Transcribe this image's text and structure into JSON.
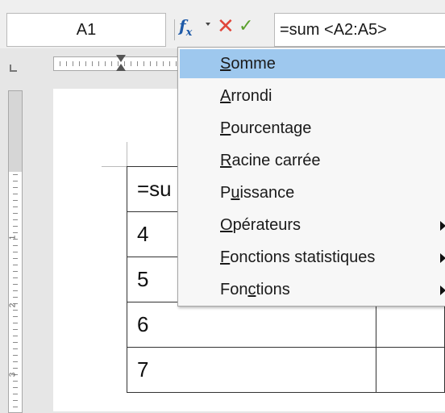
{
  "formula_bar": {
    "name_box": "A1",
    "fx_label": "f",
    "fx_sub": "x",
    "cancel_icon": "✕",
    "accept_icon": "✓",
    "formula": "=sum <A2:A5>"
  },
  "ruler": {
    "v_labels": [
      "1",
      "2",
      "3"
    ]
  },
  "table": {
    "rows": [
      "=su",
      "4",
      "5",
      "6",
      "7"
    ]
  },
  "menu": {
    "items": [
      {
        "pre": "",
        "u": "S",
        "post": "omme",
        "submenu": false,
        "highlight": true
      },
      {
        "pre": "",
        "u": "A",
        "post": "rrondi",
        "submenu": false,
        "highlight": false
      },
      {
        "pre": "",
        "u": "P",
        "post": "ourcentage",
        "submenu": false,
        "highlight": false
      },
      {
        "pre": "",
        "u": "R",
        "post": "acine carrée",
        "submenu": false,
        "highlight": false
      },
      {
        "pre": "P",
        "u": "u",
        "post": "issance",
        "submenu": false,
        "highlight": false
      },
      {
        "pre": "",
        "u": "O",
        "post": "pérateurs",
        "submenu": true,
        "highlight": false
      },
      {
        "pre": "",
        "u": "F",
        "post": "onctions statistiques",
        "submenu": true,
        "highlight": false
      },
      {
        "pre": "Fon",
        "u": "c",
        "post": "tions",
        "submenu": true,
        "highlight": false
      }
    ]
  },
  "colors": {
    "highlight": "#9ec8ee",
    "fx": "#1e5aa8",
    "cancel": "#e0453a",
    "accept": "#5aa02c"
  }
}
